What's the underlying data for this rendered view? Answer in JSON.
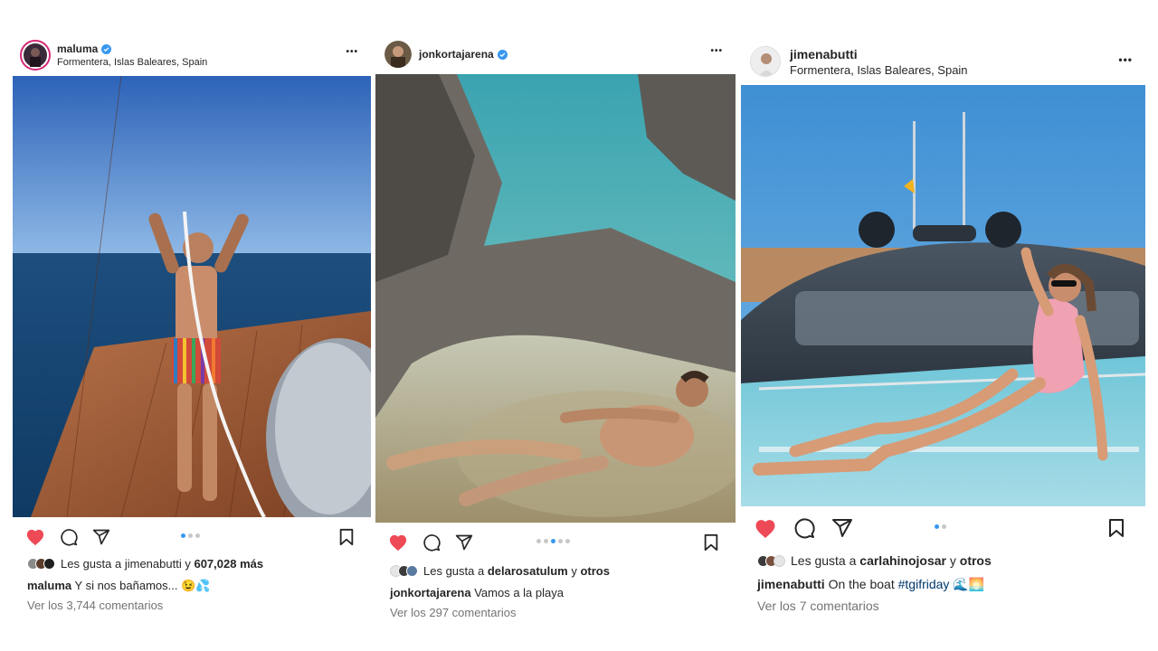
{
  "posts": [
    {
      "username": "maluma",
      "verified": true,
      "location": "Formentera, Islas Baleares, Spain",
      "more_label": "•••",
      "photo_icon": "photo-man-on-boat-with-hose",
      "liked": true,
      "carousel": {
        "count": 3,
        "active": 0
      },
      "likes_prefix": "Les gusta a",
      "likes_user": "jimenabutti",
      "likes_joiner": "y",
      "likes_rest": "607,028 más",
      "caption_user": "maluma",
      "caption_text": "Y si nos bañamos... 😉💦",
      "comments_link": "Ver los 3,744 comentarios"
    },
    {
      "username": "jonkortajarena",
      "verified": true,
      "location": "",
      "more_label": "•••",
      "photo_icon": "photo-man-in-rock-pool",
      "liked": true,
      "carousel": {
        "count": 5,
        "active": 2
      },
      "likes_prefix": "Les gusta a",
      "likes_user": "delarosatulum",
      "likes_joiner": "y",
      "likes_rest": "otros",
      "caption_user": "jonkortajarena",
      "caption_text": "Vamos a la playa",
      "comments_link": "Ver los 297 comentarios"
    },
    {
      "username": "jimenabutti",
      "verified": false,
      "location": "Formentera, Islas Baleares, Spain",
      "more_label": "•••",
      "photo_icon": "photo-woman-on-yacht",
      "liked": true,
      "carousel": {
        "count": 2,
        "active": 0
      },
      "likes_prefix": "Les gusta a",
      "likes_user": "carlahinojosar",
      "likes_joiner": "y",
      "likes_rest": "otros",
      "caption_user": "jimenabutti",
      "caption_text": "On the boat",
      "caption_hashtag": "#tgifriday",
      "caption_emoji": "🌊🌅",
      "comments_link": "Ver los 7 comentarios"
    }
  ],
  "colors": {
    "heart": "#ed4956",
    "verified": "#3797f0",
    "hashtag": "#00376b",
    "muted": "#737373"
  }
}
